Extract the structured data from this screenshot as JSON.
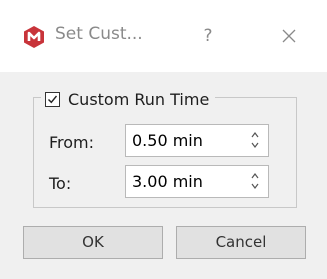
{
  "window": {
    "title": "Set Cust...",
    "help_glyph": "?",
    "app_icon": "app-logo-icon",
    "close_icon": "close-icon"
  },
  "group": {
    "checkbox_label": "Custom Run Time",
    "checked": true
  },
  "from": {
    "label": "From:",
    "value": "0.50 min"
  },
  "to": {
    "label": "To:",
    "value": "3.00 min"
  },
  "buttons": {
    "ok": "OK",
    "cancel": "Cancel"
  },
  "colors": {
    "app_icon": "#c8343a"
  }
}
